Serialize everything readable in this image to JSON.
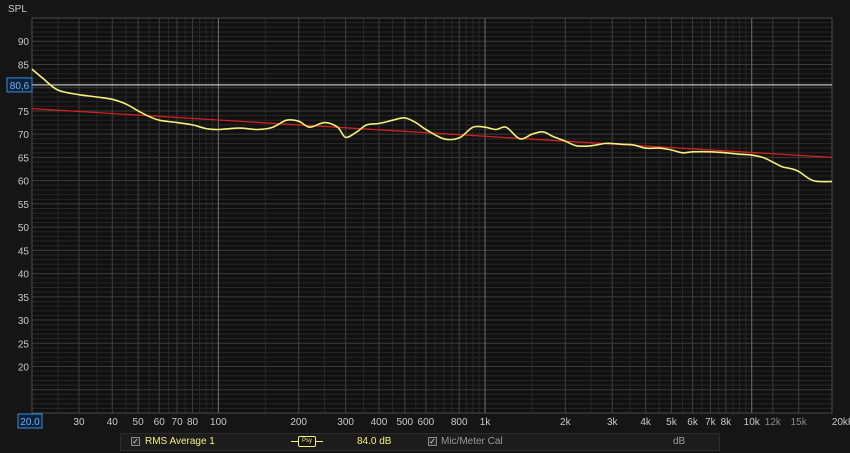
{
  "chart_data": {
    "type": "line",
    "ylabel": "SPL",
    "xscale": "log",
    "xlim": [
      20,
      20000
    ],
    "ylim": [
      10,
      95
    ],
    "y_ticks": [
      90,
      85,
      75,
      70,
      65,
      60,
      55,
      50,
      45,
      40,
      35,
      30,
      25,
      20
    ],
    "x_tick_labels": [
      {
        "value": 20,
        "label": "20.0"
      },
      {
        "value": 30,
        "label": "30"
      },
      {
        "value": 40,
        "label": "40"
      },
      {
        "value": 50,
        "label": "50"
      },
      {
        "value": 60,
        "label": "60"
      },
      {
        "value": 70,
        "label": "70"
      },
      {
        "value": 80,
        "label": "80"
      },
      {
        "value": 100,
        "label": "100"
      },
      {
        "value": 200,
        "label": "200"
      },
      {
        "value": 300,
        "label": "300"
      },
      {
        "value": 400,
        "label": "400"
      },
      {
        "value": 500,
        "label": "500"
      },
      {
        "value": 600,
        "label": "600"
      },
      {
        "value": 800,
        "label": "800"
      },
      {
        "value": 1000,
        "label": "1k"
      },
      {
        "value": 2000,
        "label": "2k"
      },
      {
        "value": 3000,
        "label": "3k"
      },
      {
        "value": 4000,
        "label": "4k"
      },
      {
        "value": 5000,
        "label": "5k"
      },
      {
        "value": 6000,
        "label": "6k"
      },
      {
        "value": 7000,
        "label": "7k"
      },
      {
        "value": 8000,
        "label": "8k"
      },
      {
        "value": 10000,
        "label": "10k"
      },
      {
        "value": 12000,
        "label": "12k"
      },
      {
        "value": 15000,
        "label": "15k"
      },
      {
        "value": 20000,
        "label": "20kHz"
      }
    ],
    "cursor": {
      "value": 80.6,
      "label": "80,6"
    },
    "series": [
      {
        "name": "RMS Average 1",
        "color": "#f2f07a",
        "points": [
          [
            20,
            84
          ],
          [
            22,
            82
          ],
          [
            25,
            79.5
          ],
          [
            30,
            78.5
          ],
          [
            35,
            78
          ],
          [
            40,
            77.5
          ],
          [
            45,
            76.5
          ],
          [
            50,
            75
          ],
          [
            55,
            73.8
          ],
          [
            60,
            73
          ],
          [
            70,
            72.5
          ],
          [
            80,
            72
          ],
          [
            90,
            71.2
          ],
          [
            100,
            71
          ],
          [
            120,
            71.3
          ],
          [
            140,
            71
          ],
          [
            160,
            71.5
          ],
          [
            180,
            73
          ],
          [
            200,
            72.8
          ],
          [
            220,
            71.5
          ],
          [
            250,
            72.5
          ],
          [
            280,
            71.5
          ],
          [
            300,
            69.3
          ],
          [
            330,
            70.5
          ],
          [
            360,
            72
          ],
          [
            400,
            72.3
          ],
          [
            450,
            73
          ],
          [
            500,
            73.5
          ],
          [
            550,
            72.5
          ],
          [
            600,
            71
          ],
          [
            700,
            69
          ],
          [
            800,
            69.2
          ],
          [
            900,
            71.5
          ],
          [
            1000,
            71.5
          ],
          [
            1100,
            71
          ],
          [
            1200,
            71.5
          ],
          [
            1350,
            69
          ],
          [
            1500,
            70
          ],
          [
            1650,
            70.5
          ],
          [
            1800,
            69.5
          ],
          [
            2000,
            68.5
          ],
          [
            2200,
            67.5
          ],
          [
            2500,
            67.5
          ],
          [
            2800,
            68
          ],
          [
            3000,
            68
          ],
          [
            3300,
            67.8
          ],
          [
            3600,
            67.7
          ],
          [
            4000,
            67
          ],
          [
            4500,
            67
          ],
          [
            5000,
            66.6
          ],
          [
            5500,
            66
          ],
          [
            6000,
            66.2
          ],
          [
            7000,
            66.2
          ],
          [
            8000,
            66
          ],
          [
            9000,
            65.7
          ],
          [
            10000,
            65.5
          ],
          [
            11000,
            65
          ],
          [
            12000,
            64
          ],
          [
            13000,
            63
          ],
          [
            14000,
            62.6
          ],
          [
            15000,
            62
          ],
          [
            17000,
            60
          ],
          [
            20000,
            59.8
          ]
        ]
      },
      {
        "name": "",
        "color": "#d42020",
        "points": [
          [
            20,
            75.5
          ],
          [
            20000,
            65
          ]
        ]
      }
    ]
  },
  "legend": {
    "trace_name": "RMS Average 1",
    "trace_badge": "Psy",
    "trace_level": "84.0 dB",
    "cal_label": "Mic/Meter Cal",
    "unit": "dB"
  },
  "colors": {
    "background": "#151515",
    "grid_major": "#3c3c3c",
    "grid_minor": "#262626",
    "decade_line": "#6e6e6e",
    "cursor_line": "#d2d2d2",
    "label_text": "#c8c8c8",
    "highlight_box": "#3d8bd6"
  }
}
